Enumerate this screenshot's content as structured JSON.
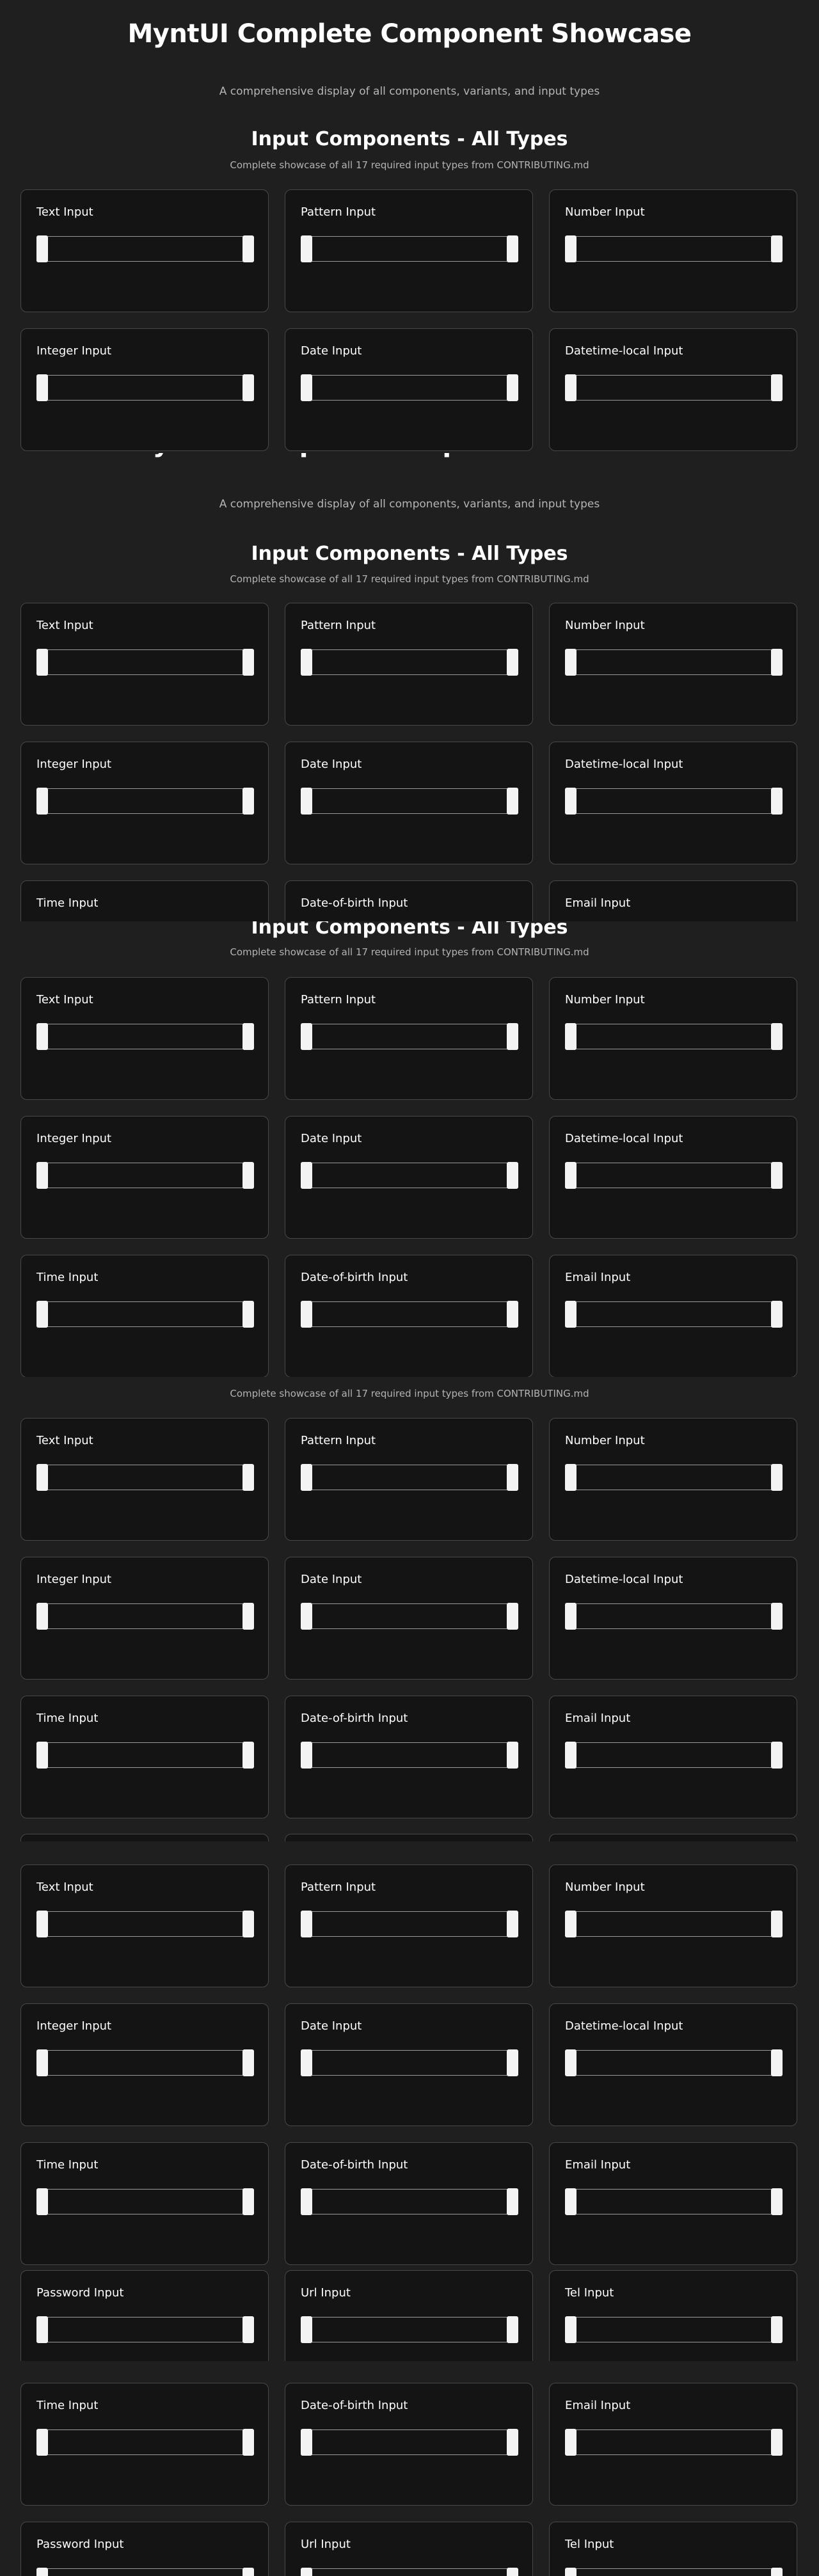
{
  "page": {
    "title": "MyntUI Complete Component Showcase",
    "subtitle": "A comprehensive display of all components, variants, and input types"
  },
  "section": {
    "title": "Input Components - All Types",
    "subtitle": "Complete showcase of all 17 required input types from CONTRIBUTING.md"
  },
  "inputs": [
    {
      "label": "Text Input"
    },
    {
      "label": "Pattern Input"
    },
    {
      "label": "Number Input"
    },
    {
      "label": "Integer Input"
    },
    {
      "label": "Date Input"
    },
    {
      "label": "Datetime-local Input"
    },
    {
      "label": "Time Input"
    },
    {
      "label": "Date-of-birth Input"
    },
    {
      "label": "Email Input"
    },
    {
      "label": "Password Input"
    },
    {
      "label": "Url Input"
    },
    {
      "label": "Tel Input"
    }
  ]
}
